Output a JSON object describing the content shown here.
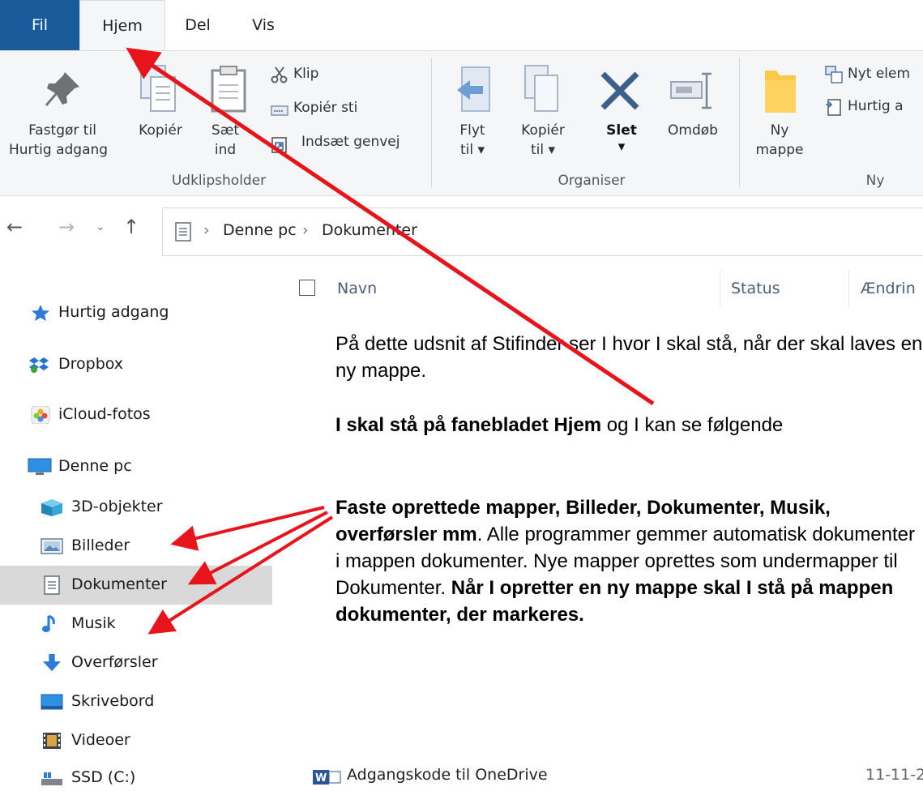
{
  "tabs": {
    "fil": "Fil",
    "hjem": "Hjem",
    "del": "Del",
    "vis": "Vis"
  },
  "ribbon": {
    "pin": {
      "line1": "Fastgør til",
      "line2": "Hurtig adgang"
    },
    "copy": "Kopiér",
    "paste": {
      "line1": "Sæt",
      "line2": "ind"
    },
    "cut": "Klip",
    "copy_path": "Kopiér sti",
    "paste_shortcut": "Indsæt genvej",
    "group_clipboard": "Udklipsholder",
    "move": {
      "line1": "Flyt",
      "line2": "til ▾"
    },
    "copy_to": {
      "line1": "Kopiér",
      "line2": "til ▾"
    },
    "delete": {
      "line1": "Slet",
      "line2": "▾"
    },
    "rename": "Omdøb",
    "group_organize": "Organiser",
    "new_folder": {
      "line1": "Ny",
      "line2": "mappe"
    },
    "new_item": "Nyt elem",
    "quick_access_item": "Hurtig a",
    "group_new": "Ny"
  },
  "address": {
    "crumb1": "Denne pc",
    "crumb2": "Dokumenter",
    "sep": "›"
  },
  "columns": {
    "name": "Navn",
    "status": "Status",
    "modified": "Ændrin"
  },
  "sidebar": {
    "quick": "Hurtig adgang",
    "dropbox": "Dropbox",
    "icloud": "iCloud-fotos",
    "thispc": "Denne pc",
    "objects3d": "3D-objekter",
    "pictures": "Billeder",
    "documents": "Dokumenter",
    "music": "Musik",
    "downloads": "Overførsler",
    "desktop": "Skrivebord",
    "videos": "Videoer",
    "ssd": "SSD (C:)"
  },
  "note": {
    "p1": "På dette udsnit af Stifinder ser I hvor I skal stå, når der skal laves en ny mappe.",
    "p2_bold": "I skal stå på fanebladet Hjem",
    "p2_rest": " og I kan se følgende",
    "p3_bold": "Faste oprettede mapper, Billeder, Dokumenter, Musik, overførsler mm",
    "p3_rest": ". Alle programmer gemmer automatisk dokumenter i mappen dokumenter. Nye mapper oprettes som undermapper til Dokumenter.  ",
    "p3_bold2": "Når I opretter en ny mappe skal I stå på mappen dokumenter, der markeres."
  },
  "bottom": {
    "file": "Adgangskode til  OneDrive",
    "date": "11-11-2"
  },
  "colors": {
    "file_tab": "#1a5b9c",
    "arrow": "#e8141b",
    "selected": "#d9d9d9"
  }
}
